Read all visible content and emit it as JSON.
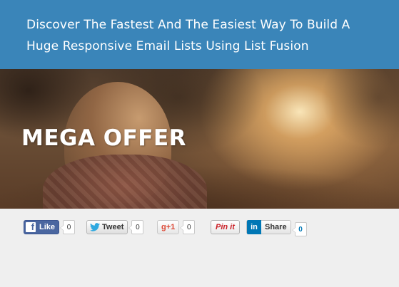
{
  "header": {
    "title": "Discover The Fastest And The Easiest Way To Build A Huge Responsive Email Lists Using List Fusion"
  },
  "hero": {
    "title": "MEGA OFFER"
  },
  "social": {
    "facebook": {
      "icon": "facebook-icon",
      "label": "Like",
      "count": "0",
      "color": "#4a66a0"
    },
    "twitter": {
      "icon": "twitter-icon",
      "label": "Tweet",
      "count": "0",
      "color": "#1da1f2"
    },
    "google": {
      "icon": "google-plus-icon",
      "label": "g+1",
      "count": "0",
      "color": "#dd4b39"
    },
    "pinterest": {
      "icon": "pinterest-icon",
      "label": "Pin it",
      "count": "",
      "color": "#cb2027"
    },
    "linkedin": {
      "icon": "linkedin-icon",
      "icon_text": "in",
      "label": "Share",
      "count": "0",
      "color": "#0077b5"
    }
  },
  "colors": {
    "header_bg": "#3a85b9",
    "page_bg": "#efefef"
  }
}
